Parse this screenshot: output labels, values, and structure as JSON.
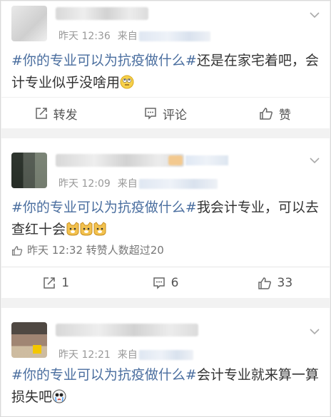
{
  "posts": [
    {
      "time": "昨天 12:36",
      "source_prefix": "来自",
      "topic": "#你的专业可以为抗疫做什么#",
      "text": "还是在家宅着吧，会计专业似乎没啥用",
      "emoji": "roll-eyes-emoji",
      "actions": [
        {
          "icon": "share-icon",
          "label": "转发"
        },
        {
          "icon": "comment-icon",
          "label": "评论"
        },
        {
          "icon": "like-icon",
          "label": "赞"
        }
      ]
    },
    {
      "time": "昨天 12:09",
      "source_prefix": "来自",
      "topic": "#你的专业可以为抗疫做什么#",
      "text": "我会计专业，可以去查红十会",
      "emoji": "doge-emoji",
      "repost_note": "昨天 12:32 转赞人数超过20",
      "actions": [
        {
          "icon": "share-icon",
          "label": "1"
        },
        {
          "icon": "comment-icon",
          "label": "6"
        },
        {
          "icon": "like-icon",
          "label": "33"
        }
      ]
    },
    {
      "time": "昨天 12:21",
      "source_prefix": "来自",
      "topic": "#你的专业可以为抗疫做什么#",
      "text": "会计专业就来算一算损失吧",
      "emoji": "crying-emoji"
    }
  ],
  "colors": {
    "topic": "#4a6e9f",
    "meta": "#999999"
  }
}
